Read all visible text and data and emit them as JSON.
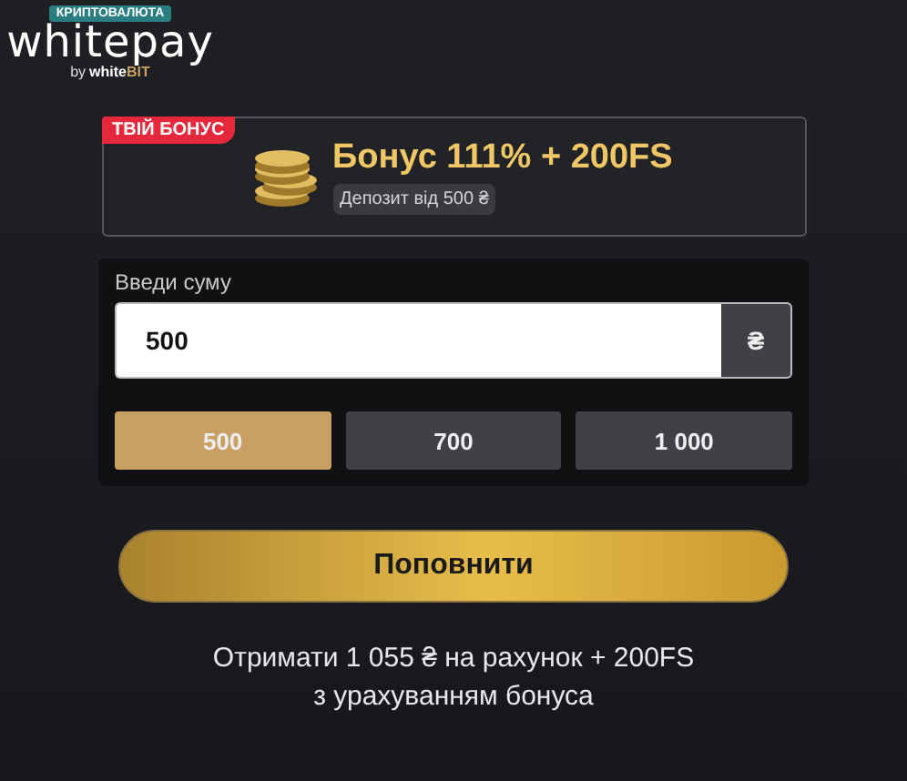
{
  "logo": {
    "badge": "КРИПТОВАЛЮТА",
    "name": "whitepay",
    "by": "by",
    "brand_main": "white",
    "brand_accent": "BIT"
  },
  "bonus": {
    "tag": "ТВІЙ БОНУС",
    "title": "Бонус 111% + 200FS",
    "note": "Депозит від 500 ₴"
  },
  "amount": {
    "label": "Введи суму",
    "value": "500",
    "currency": "₴"
  },
  "presets": [
    {
      "label": "500",
      "selected": true
    },
    {
      "label": "700",
      "selected": false
    },
    {
      "label": "1 000",
      "selected": false
    }
  ],
  "submit": "Поповнити",
  "summary": [
    "Отримати 1 055 ₴ на рахунок + 200FS",
    "з урахуванням бонуса"
  ]
}
